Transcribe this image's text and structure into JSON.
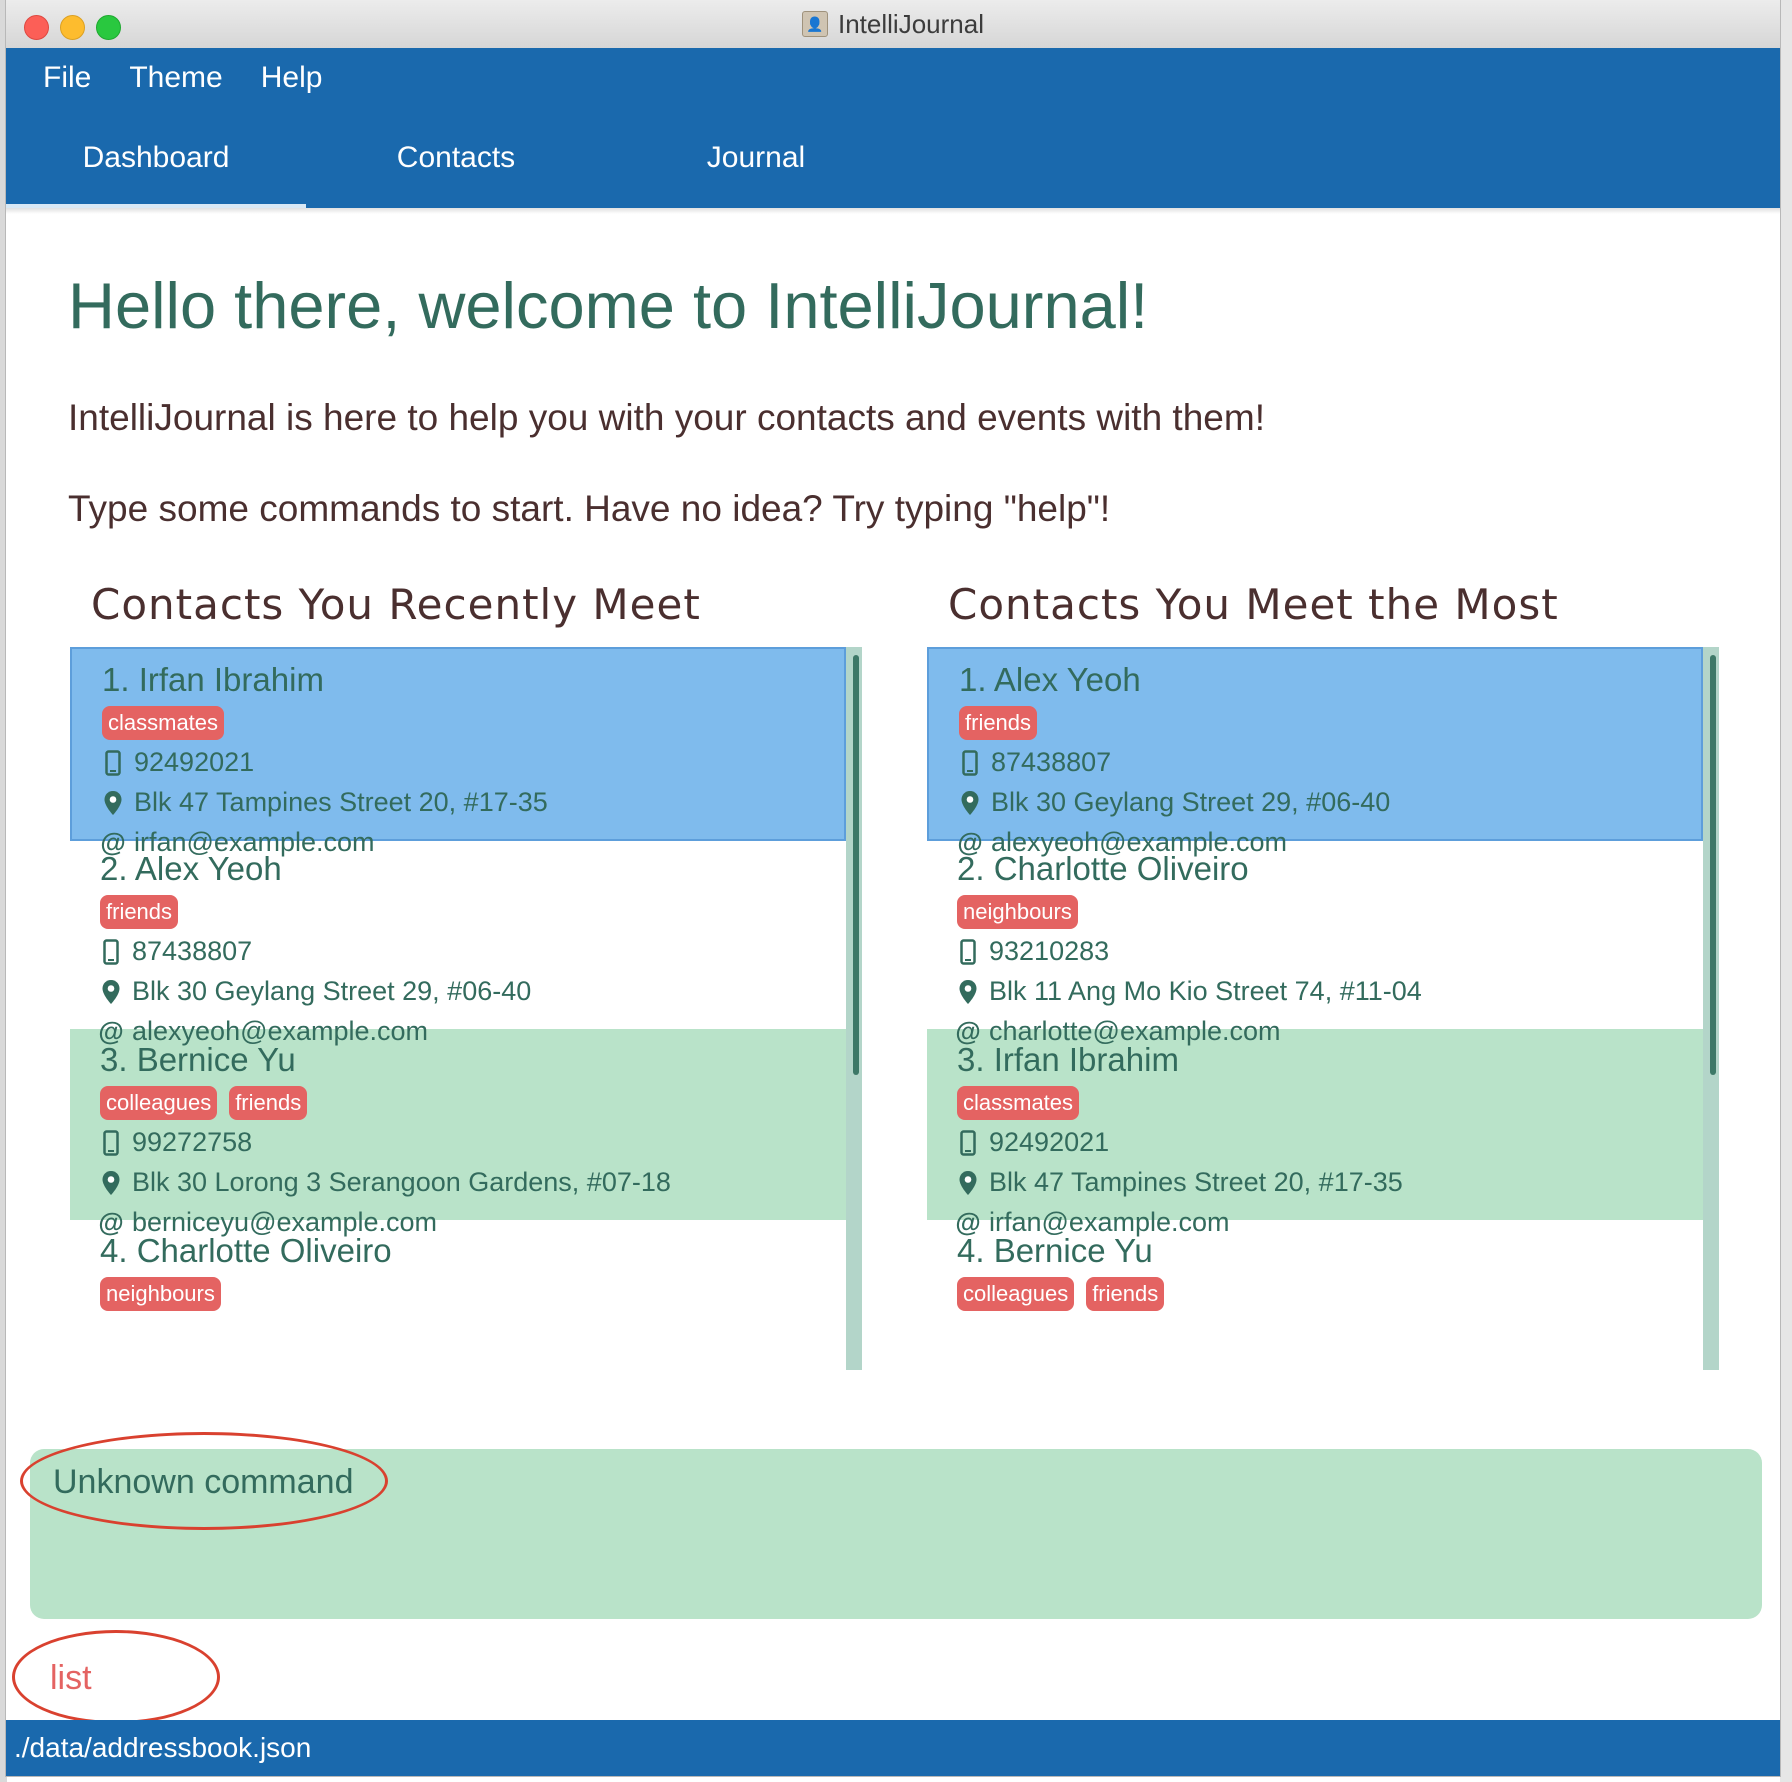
{
  "window": {
    "title": "IntelliJournal"
  },
  "menu": [
    "File",
    "Theme",
    "Help"
  ],
  "tabs": [
    {
      "label": "Dashboard",
      "active": true
    },
    {
      "label": "Contacts",
      "active": false
    },
    {
      "label": "Journal",
      "active": false
    }
  ],
  "dashboard": {
    "welcome": "Hello there, welcome to IntelliJournal!",
    "intro1": "IntelliJournal is here to help you with your contacts and events with them!",
    "intro2": "Type some commands to start. Have no idea? Try typing \"help\"!",
    "recent_title": "Contacts You Recently Meet",
    "most_title": "Contacts You Meet the Most"
  },
  "recent": [
    {
      "index": "1.",
      "name": "Irfan Ibrahim",
      "tags": [
        "classmates"
      ],
      "phone": "92492021",
      "address": "Blk 47 Tampines Street 20, #17-35",
      "email": "irfan@example.com",
      "style": "sel"
    },
    {
      "index": "2.",
      "name": "Alex Yeoh",
      "tags": [
        "friends"
      ],
      "phone": "87438807",
      "address": "Blk 30 Geylang Street 29, #06-40",
      "email": "alexyeoh@example.com",
      "style": "plain"
    },
    {
      "index": "3.",
      "name": "Bernice Yu",
      "tags": [
        "colleagues",
        "friends"
      ],
      "phone": "99272758",
      "address": "Blk 30 Lorong 3 Serangoon Gardens, #07-18",
      "email": "berniceyu@example.com",
      "style": "alt"
    },
    {
      "index": "4.",
      "name": "Charlotte Oliveiro",
      "tags": [
        "neighbours"
      ],
      "phone": "",
      "address": "",
      "email": "",
      "style": "plain"
    }
  ],
  "most": [
    {
      "index": "1.",
      "name": "Alex Yeoh",
      "tags": [
        "friends"
      ],
      "phone": "87438807",
      "address": "Blk 30 Geylang Street 29, #06-40",
      "email": "alexyeoh@example.com",
      "style": "sel"
    },
    {
      "index": "2.",
      "name": "Charlotte Oliveiro",
      "tags": [
        "neighbours"
      ],
      "phone": "93210283",
      "address": "Blk 11 Ang Mo Kio Street 74, #11-04",
      "email": "charlotte@example.com",
      "style": "plain"
    },
    {
      "index": "3.",
      "name": "Irfan Ibrahim",
      "tags": [
        "classmates"
      ],
      "phone": "92492021",
      "address": "Blk 47 Tampines Street 20, #17-35",
      "email": "irfan@example.com",
      "style": "alt"
    },
    {
      "index": "4.",
      "name": "Bernice Yu",
      "tags": [
        "colleagues",
        "friends"
      ],
      "phone": "",
      "address": "",
      "email": "",
      "style": "plain"
    }
  ],
  "result": {
    "text": "Unknown command"
  },
  "command": {
    "value": "list"
  },
  "status": {
    "path": "./data/addressbook.json"
  },
  "colors": {
    "header_blue": "#1a69ad",
    "selected_card": "#7fbbed",
    "alt_card": "#b9e3c9",
    "tag": "#e46362",
    "text_green": "#336b5d",
    "annotation_ring": "#d9412f"
  },
  "icons": {
    "phone": "phone-icon",
    "address": "location-pin-icon",
    "email": "at-sign-icon"
  }
}
